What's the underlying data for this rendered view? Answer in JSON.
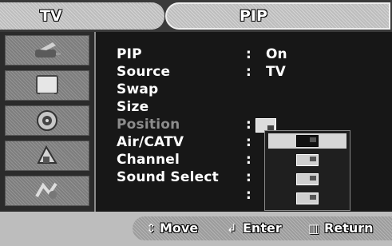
{
  "header": {
    "left_tab": "TV",
    "title": "PIP"
  },
  "sidebar": {
    "icons": [
      "antenna-icon",
      "picture-icon",
      "sound-icon",
      "channel-icon",
      "setup-icon"
    ]
  },
  "menu": {
    "items": [
      {
        "label": "PIP",
        "value": "On"
      },
      {
        "label": "Source",
        "value": "TV"
      },
      {
        "label": "Swap",
        "value": ""
      },
      {
        "label": "Size",
        "value": ""
      },
      {
        "label": "Position",
        "value": ""
      },
      {
        "label": "Air/CATV",
        "value": ""
      },
      {
        "label": "Channel",
        "value": ""
      },
      {
        "label": "Sound Select",
        "value": ""
      }
    ],
    "colon": ":"
  },
  "footer": {
    "move_label": "Move",
    "enter_label": "Enter",
    "return_label": "Return"
  }
}
